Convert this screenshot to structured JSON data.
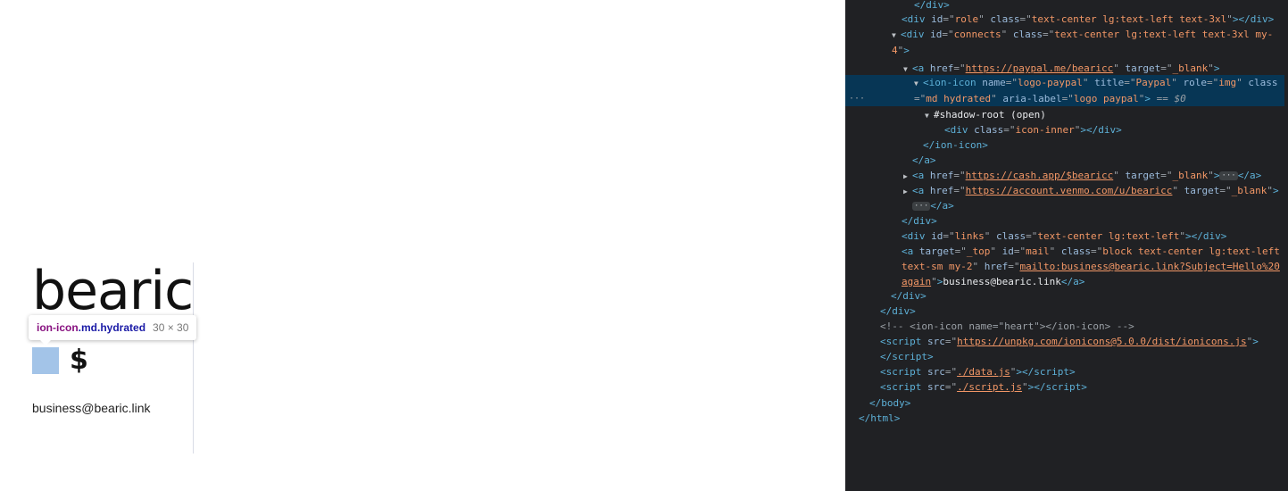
{
  "page": {
    "name": "bearic",
    "dollar": "$",
    "email": "business@bearic.link",
    "tooltip": {
      "tag": "ion-icon",
      "classes": ".md.hydrated",
      "size": "30 × 30"
    }
  },
  "devtools": {
    "lines": [
      {
        "html": "<span class='tag'>&lt;/div&gt;</span>"
      },
      {
        "html": "<span class='tag'>&lt;div</span> <span class='attr'>id</span>=\"<span class='val'>role</span>\" <span class='attr'>class</span>=\"<span class='val'>text-center lg:text-left text-3xl</span>\"<span class='tag'>&gt;&lt;/div&gt;</span>"
      },
      {
        "html": "<span class='tri'>▼</span><span class='tag'>&lt;div</span> <span class='attr'>id</span>=\"<span class='val'>connects</span>\" <span class='attr'>class</span>=\"<span class='val'>text-center lg:text-left text-3xl my-4</span>\"<span class='tag'>&gt;</span>"
      },
      {
        "html": "<span class='tri'>▼</span><span class='tag'>&lt;a</span> <span class='attr'>href</span>=\"<span class='link'>https://paypal.me/bearicc</span>\" <span class='attr'>target</span>=\"<span class='val'>_blank</span>\"<span class='tag'>&gt;</span>"
      },
      {
        "html": "<span class='tri'>▼</span><span class='tag'>&lt;ion-icon</span> <span class='attr'>name</span>=\"<span class='val'>logo-paypal</span>\" <span class='attr'>title</span>=\"<span class='val'>Paypal</span>\" <span class='attr'>role</span>=\"<span class='val'>img</span>\" <span class='attr'>class</span>=\"<span class='val'>md hydrated</span>\" <span class='attr'>aria-label</span>=\"<span class='val'>logo paypal</span>\"<span class='tag'>&gt;</span> <span class='eq'>== $0</span>"
      },
      {
        "html": "<span class='tri'>▼</span><span class='txt'>#shadow-root (open)</span>"
      },
      {
        "html": "<span class='tag'>&lt;div</span> <span class='attr'>class</span>=\"<span class='val'>icon-inner</span>\"<span class='tag'>&gt;&lt;/div&gt;</span>"
      },
      {
        "html": "<span class='tag'>&lt;/ion-icon&gt;</span>"
      },
      {
        "html": "<span class='tag'>&lt;/a&gt;</span>"
      },
      {
        "html": "<span class='tri'>▶</span><span class='tag'>&lt;a</span> <span class='attr'>href</span>=\"<span class='link'>https://cash.app/$bearicc</span>\" <span class='attr'>target</span>=\"<span class='val'>_blank</span>\"<span class='tag'>&gt;</span><span class='dots'>···</span><span class='tag'>&lt;/a&gt;</span>"
      },
      {
        "html": "<span class='tri'>▶</span><span class='tag'>&lt;a</span> <span class='attr'>href</span>=\"<span class='link'>https://account.venmo.com/u/bearicc</span>\" <span class='attr'>target</span>=\"<span class='val'>_blank</span>\"<span class='tag'>&gt;</span>"
      },
      {
        "html": "<span class='dots'>···</span><span class='tag'>&lt;/a&gt;</span>"
      },
      {
        "html": "<span class='tag'>&lt;/div&gt;</span>"
      },
      {
        "html": "<span class='tag'>&lt;div</span> <span class='attr'>id</span>=\"<span class='val'>links</span>\" <span class='attr'>class</span>=\"<span class='val'>text-center lg:text-left</span>\"<span class='tag'>&gt;&lt;/div&gt;</span>"
      },
      {
        "html": "<span class='tag'>&lt;a</span> <span class='attr'>target</span>=\"<span class='val'>_top</span>\" <span class='attr'>id</span>=\"<span class='val'>mail</span>\" <span class='attr'>class</span>=\"<span class='val'>block text-center lg:text-left text-sm my-2</span>\" <span class='attr'>href</span>=\"<span class='link'>mailto:business@bearic.link?Subject=Hello%20again</span>\"<span class='tag'>&gt;</span><span class='txt'>business@bearic.link</span><span class='tag'>&lt;/a&gt;</span>"
      },
      {
        "html": "<span class='tag'>&lt;/div&gt;</span>"
      },
      {
        "html": "<span class='tag'>&lt;/div&gt;</span>"
      },
      {
        "html": "<span class='cmt'>&lt;!-- &lt;ion-icon name=\"heart\"&gt;&lt;/ion-icon&gt; --&gt;</span>"
      },
      {
        "html": "<span class='tag'>&lt;script</span> <span class='attr'>src</span>=\"<span class='link'>https://unpkg.com/ionicons@5.0.0/dist/ionicons.js</span>\"<span class='tag'>&gt;</span>"
      },
      {
        "html": "<span class='tag'>&lt;/script&gt;</span>"
      },
      {
        "html": "<span class='tag'>&lt;script</span> <span class='attr'>src</span>=\"<span class='link'>./data.js</span>\"<span class='tag'>&gt;&lt;/script&gt;</span>"
      },
      {
        "html": "<span class='tag'>&lt;script</span> <span class='attr'>src</span>=\"<span class='link'>./script.js</span>\"<span class='tag'>&gt;&lt;/script&gt;</span>"
      },
      {
        "html": "<span class='tag'>&lt;/body&gt;</span>"
      },
      {
        "html": "<span class='tag'>&lt;/html&gt;</span>"
      }
    ]
  }
}
